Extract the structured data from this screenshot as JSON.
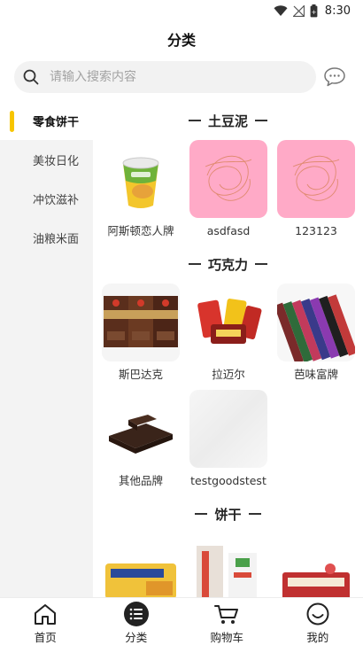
{
  "status_bar": {
    "time": "8:30",
    "icons": [
      "wifi-icon",
      "no-signal-icon",
      "battery-icon"
    ]
  },
  "header": {
    "title": "分类"
  },
  "search": {
    "placeholder": "请输入搜索内容",
    "value": "",
    "icon": "search-icon",
    "chat_icon": "chat-bubble-icon"
  },
  "sidebar": {
    "items": [
      {
        "label": "零食饼干",
        "active": true
      },
      {
        "label": "美妆日化",
        "active": false
      },
      {
        "label": "冲饮滋补",
        "active": false
      },
      {
        "label": "油粮米面",
        "active": false
      }
    ]
  },
  "sections": [
    {
      "title": "土豆泥",
      "products": [
        {
          "name": "阿斯顿恋人牌",
          "image": "potato-cup"
        },
        {
          "name": "asdfasd",
          "image": "pink-scribble"
        },
        {
          "name": "123123",
          "image": "pink-scribble"
        }
      ]
    },
    {
      "title": "巧克力",
      "products": [
        {
          "name": "斯巴达克",
          "image": "chocolate-bars"
        },
        {
          "name": "拉迈尔",
          "image": "candy-pack"
        },
        {
          "name": "芭味富牌",
          "image": "chocolate-row"
        },
        {
          "name": "其他品牌",
          "image": "dark-chocolate"
        },
        {
          "name": "testgoodstest",
          "image": "grey-blank"
        }
      ]
    },
    {
      "title": "饼干",
      "products": [
        {
          "name": "",
          "image": "cracker-pack"
        },
        {
          "name": "",
          "image": "wafer-pack"
        },
        {
          "name": "",
          "image": "biscuit-box"
        }
      ]
    }
  ],
  "tabbar": {
    "items": [
      {
        "label": "首页",
        "icon": "home-icon",
        "active": false
      },
      {
        "label": "分类",
        "icon": "category-list-icon",
        "active": true
      },
      {
        "label": "购物车",
        "icon": "cart-icon",
        "active": false
      },
      {
        "label": "我的",
        "icon": "smile-icon",
        "active": false
      }
    ]
  },
  "colors": {
    "accent": "#f7c500",
    "sidebar_bg": "#f3f3f3",
    "pink_placeholder": "#ffaac7"
  }
}
